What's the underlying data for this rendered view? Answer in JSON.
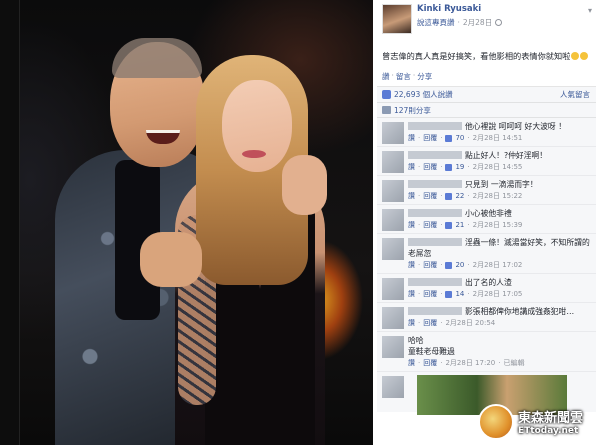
{
  "post": {
    "author": "Kinki Ryusaki",
    "meta_link": "說這專頁讚",
    "meta_sep": "·",
    "date": "2月28日",
    "text": "曾志偉的真人真是好搞笑，看他影相的表情你就知啦",
    "actions": {
      "like": "讚",
      "comment": "留言",
      "share": "分享",
      "sep": "·"
    }
  },
  "ufi": {
    "likes": "22,693 個人說讚",
    "top_comments": "人氣留言",
    "shares": "127則分享"
  },
  "comments": [
    {
      "text": "他心裡說 呵呵呵 好大波呀 ！",
      "like": "讚",
      "reply": "回覆",
      "likes": "70",
      "date": "2月28日 14:51"
    },
    {
      "text": "點止好人！?仲好淫啊！",
      "like": "讚",
      "reply": "回覆",
      "likes": "19",
      "date": "2月28日 14:55"
    },
    {
      "text": "只見到 一滴湯而字！",
      "like": "讚",
      "reply": "回覆",
      "likes": "22",
      "date": "2月28日 15:22"
    },
    {
      "text": "小心被他非禮",
      "like": "讚",
      "reply": "回覆",
      "likes": "21",
      "date": "2月28日 15:39"
    },
    {
      "text": "淫蟲一條！滅湯當好笑，不知所謂的老屌忽",
      "like": "讚",
      "reply": "回覆",
      "likes": "20",
      "date": "2月28日 17:02"
    },
    {
      "text": "出了名的人渣",
      "like": "讚",
      "reply": "回覆",
      "likes": "14",
      "date": "2月28日 17:05"
    },
    {
      "text": "影張相都俾你地講成強姦犯咁…",
      "like": "讚",
      "reply": "回覆",
      "likes": "",
      "date": "2月28日 20:54"
    },
    {
      "text": "哈哈\n童鞋老母難過",
      "like": "讚",
      "reply": "回覆",
      "likes": "",
      "date": "2月28日 17:20",
      "extra": "已編輯"
    }
  ],
  "watermark": {
    "cn": "東森新聞雲",
    "en": "ETtoday.net"
  },
  "icons": [
    "globe-icon",
    "chevron-down-icon",
    "thumbs-up-icon",
    "share-icon"
  ],
  "colors": {
    "link": "#3b5998",
    "meta": "#90949c",
    "ufi_bg": "#f6f7f9",
    "like": "#5b7bd5"
  }
}
